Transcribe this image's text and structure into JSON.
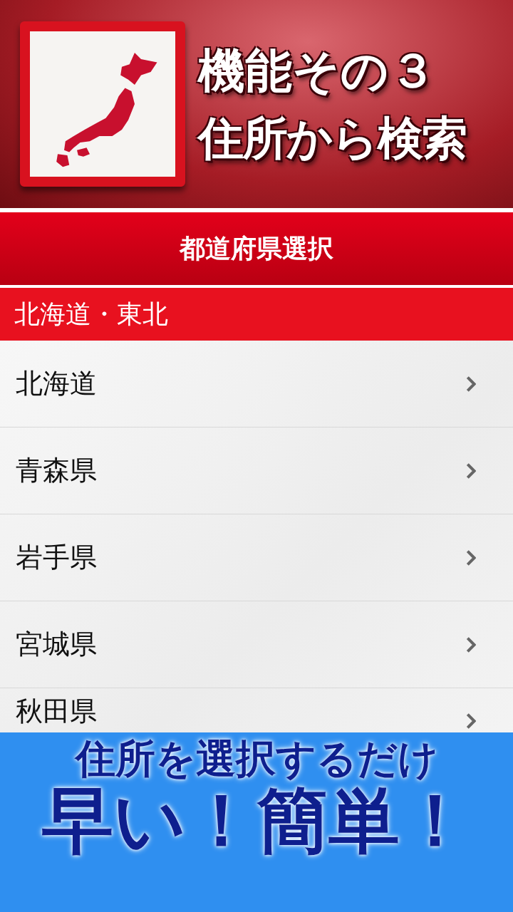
{
  "header": {
    "title_lines": [
      "機能その３",
      "住所から検索"
    ]
  },
  "nav_bar": {
    "title": "都道府県選択"
  },
  "section": {
    "title": "北海道・東北"
  },
  "rows": [
    {
      "label": "北海道"
    },
    {
      "label": "青森県"
    },
    {
      "label": "岩手県"
    },
    {
      "label": "宮城県"
    },
    {
      "label": "秋田県"
    }
  ],
  "banner": {
    "lines": [
      "住所を選択するだけ",
      "早い！簡単！"
    ]
  }
}
